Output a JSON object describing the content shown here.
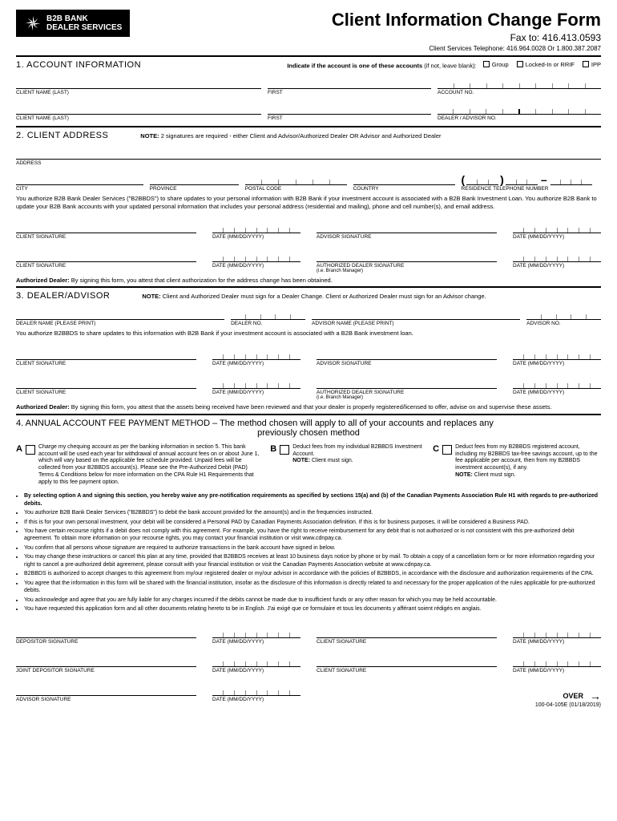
{
  "header": {
    "brand_line1": "B2B BANK",
    "brand_line2": "DEALER SERVICES",
    "title": "Client Information Change Form",
    "fax": "Fax to: 416.413.0593",
    "phone": "Client Services Telephone: 416.964.0028 Or 1.800.387.2087"
  },
  "s1": {
    "heading": "1.  ACCOUNT INFORMATION",
    "indicate": "Indicate if the account is one of these accounts",
    "indicate_paren": "(if not, leave blank):",
    "chk1": "Group",
    "chk2": "Locked-In or RRIF",
    "chk3": "IPP",
    "client_last": "CLIENT NAME (LAST)",
    "first": "FIRST",
    "account_no": "ACCOUNT NO.",
    "dealer_advisor_no": "DEALER / ADVISOR NO."
  },
  "s2": {
    "heading": "2.  CLIENT ADDRESS",
    "note_label": "NOTE:",
    "note": "2 signatures are required - either Client and Advisor/Authorized Dealer OR Advisor and Authorized Dealer",
    "address": "ADDRESS",
    "city": "CITY",
    "province": "PROVINCE",
    "postal": "POSTAL CODE",
    "country": "COUNTRY",
    "phone": "RESIDENCE TELEPHONE NUMBER",
    "auth": "You authorize B2B Bank Dealer Services (\"B2BBDS\") to share updates to your personal information with B2B Bank if your investment account is associated with a B2B Bank Investment Loan.  You authorize B2B Bank to update your B2B Bank accounts with your updated personal information that includes your personal address (residential and mailing), phone and cell number(s), and email address.",
    "client_sig": "CLIENT SIGNATURE",
    "date": "DATE (mm/dd/yyyy)",
    "advisor_sig": "ADVISOR SIGNATURE",
    "auth_dealer_sig": "AUTHORIZED DEALER SIGNATURE",
    "branch_mgr": "(i.e. Branch Manager)",
    "auth_dealer_note_label": "Authorized Dealer:",
    "auth_dealer_note": "By signing this form, you attest that client authorization for the address change has been obtained."
  },
  "s3": {
    "heading": "3.  DEALER/ADVISOR",
    "note_label": "NOTE:",
    "note": "Client and Authorized Dealer must sign for a Dealer Change. Client or Authorized Dealer must sign for an Advisor change.",
    "dealer_name": "DEALER NAME (PLEASE PRINT)",
    "dealer_no": "DEALER NO.",
    "advisor_name": "ADVISOR NAME (PLEASE PRINT)",
    "advisor_no": "ADVISOR NO.",
    "auth": "You authorize B2BBDS to share updates to this information with B2B Bank if your investment account is associated with a B2B Bank investment loan.",
    "auth_dealer_note_label": "Authorized Dealer:",
    "auth_dealer_note": "By signing this form, you attest that the assets being received have been reviewed and that your dealer is properly registered/licensed to offer, advise on and supervise these assets."
  },
  "s4": {
    "heading": "4.  ANNUAL ACCOUNT FEE PAYMENT METHOD – The method chosen will apply to all of your accounts and replaces any",
    "heading2": "previously chosen method",
    "A": "A",
    "A_text": "Charge my chequing account as per the banking information in section 5. This bank account will be used each year for withdrawal of annual account fees on or about June 1, which will vary based on the applicable fee schedule provided. Unpaid fees will be collected from your B2BBDS account(s). Please see the Pre-Authorized Debit (PAD) Terms & Conditions below for more information on the CPA Rule H1 Requirements that apply to this fee payment option.",
    "B": "B",
    "B_text": "Deduct fees from my individual B2BBDS Investment Account.",
    "B_note_label": "NOTE:",
    "B_note": "Client must sign.",
    "C": "C",
    "C_text": "Deduct fees from my B2BBDS registered account, including my B2BBDS tax-free savings account, up to the fee applicable per account, then from my B2BBDS investment account(s), if any.",
    "C_note_label": "NOTE:",
    "C_note": "Client must sign.",
    "bullets": [
      "By selecting option A and signing this section, you hereby waive any pre-notification requirements as specified by sections 15(a) and (b) of the Canadian Payments Association Rule H1 with regards to pre-authorized debits.",
      "You authorize B2B Bank Dealer Services (\"B2BBDS\") to debit the bank account provided for the amount(s) and in the frequencies instructed.",
      "If this is for your own personal investment, your debit will be considered a Personal PAD by Canadian Payments Association definition. If this is for business purposes, it will be considered a Business PAD.",
      "You have certain recourse rights if a debit does not comply with this agreement. For example, you have the right to receive reimbursement for any debit that is not authorized or is not consistent with this pre-authorized debit agreement. To obtain more information on your recourse rights, you may contact your financial institution or visit www.cdnpay.ca.",
      "You confirm that all persons whose signature are required to authorize transactions in the bank account have signed in below.",
      "You may change these instructions or cancel this plan at any time, provided that B2BBDS receives at least 10 business days notice by phone or by mail. To obtain a copy of a cancellation form or for more information regarding your right to cancel a pre-authorized debit agreement, please consult with your financial institution or visit the Canadian Payments Association website at www.cdnpay.ca.",
      "B2BBDS is authorized to accept changes to this agreement from my/our registered dealer or my/our advisor in accordance with the policies of B2BBDS, in accordance with the disclosure and authorization requirements of the CPA.",
      "You agree that the information in this form will be shared with the financial institution, insofar as the disclosure of this information is directly related to and necessary for the proper application of the rules applicable for pre-authorized debits.",
      "You acknowledge and agree that you are fully liable for any charges incurred if the debits cannot be made due to insufficient funds or any other reason for which you may be held accountable.",
      "You have requested this application form and all other documents relating hereto to be in English. J'ai exigé que ce formulaire et tous les documents y afférant soient rédigés en anglais."
    ],
    "depositor_sig": "DEPOSITOR SIGNATURE",
    "joint_depositor_sig": "JOINT DEPOSITOR SIGNATURE",
    "client_sig": "CLIENT SIGNATURE",
    "advisor_sig": "ADVISOR SIGNATURE",
    "date": "DATE (mm/dd/yyyy)"
  },
  "footer": {
    "over": "OVER",
    "form_id": "100-04-105E (01/18/2019)"
  }
}
